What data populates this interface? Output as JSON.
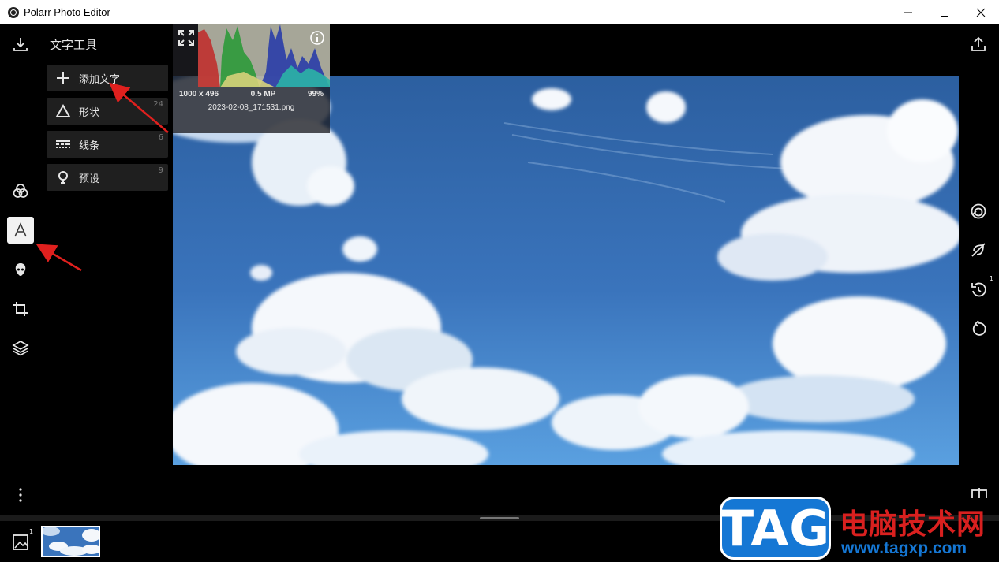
{
  "window": {
    "title": "Polarr Photo Editor",
    "controls": [
      "minimize-icon",
      "maximize-icon",
      "close-icon"
    ]
  },
  "left_rail": {
    "top_icon": "download-icon",
    "items": [
      {
        "icon": "filters-icon"
      },
      {
        "icon": "text-tool-icon",
        "active": true
      },
      {
        "icon": "face-icon"
      },
      {
        "icon": "crop-icon"
      },
      {
        "icon": "layers-icon"
      }
    ],
    "bottom_icon": "more-vertical-icon"
  },
  "tool_panel": {
    "title": "文字工具",
    "items": [
      {
        "label": "添加文字",
        "icon": "plus-icon",
        "count": ""
      },
      {
        "label": "形状",
        "icon": "triangle-icon",
        "count": "24"
      },
      {
        "label": "线条",
        "icon": "lines-icon",
        "count": "6"
      },
      {
        "label": "预设",
        "icon": "bulb-icon",
        "count": "9"
      }
    ]
  },
  "histogram": {
    "dimensions": "1000 x 496",
    "megapixels": "0.5 MP",
    "zoom": "99%",
    "filename": "2023-02-08_171531.png"
  },
  "right_rail": {
    "top_icon": "share-icon",
    "items": [
      {
        "icon": "compare-icon"
      },
      {
        "icon": "disable-icon"
      },
      {
        "icon": "history-icon",
        "badge": "1"
      },
      {
        "icon": "reset-icon"
      }
    ]
  },
  "film_strip": {
    "gallery_badge": "1"
  },
  "watermark": {
    "tag": "TAG",
    "cn": "电脑技术网",
    "url": "www.tagxp.com"
  },
  "colors": {
    "sky_top": "#2c5fa0",
    "sky_mid": "#3a74bc",
    "sky_bottom": "#5aa0e0",
    "arrow": "#e0201e",
    "watermark_blue": "#1577d4",
    "watermark_red": "#d9201f"
  }
}
